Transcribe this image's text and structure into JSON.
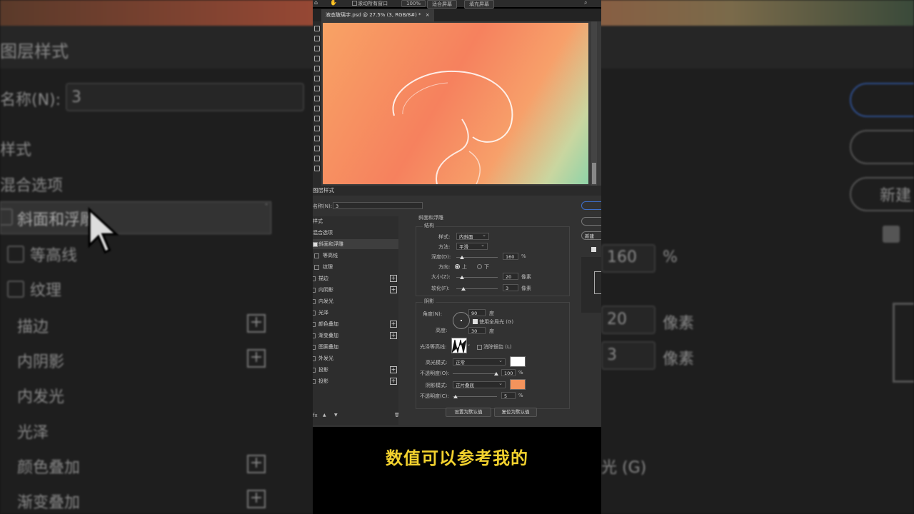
{
  "app": {
    "window_menu": {
      "scroll_all": "滚动所有窗口",
      "zoom": "100%",
      "fit_screen": "适合屏幕",
      "fill_screen": "填充屏幕"
    },
    "document_tab": "液态玻璃字.psd @ 27.5% (3, RGB/8#) *",
    "tab_close": "×"
  },
  "dialog": {
    "title": "图层样式",
    "name_label": "名称(N):",
    "name_value": "3",
    "styles_header": "样式",
    "blend_options": "混合选项",
    "items": [
      {
        "label": "斜面和浮雕",
        "checked": true,
        "plus": false,
        "active": true
      },
      {
        "label": "等高线",
        "checked": false,
        "plus": false,
        "sub": true
      },
      {
        "label": "纹理",
        "checked": false,
        "plus": false,
        "sub": true
      },
      {
        "label": "描边",
        "checked": false,
        "plus": true
      },
      {
        "label": "内阴影",
        "checked": false,
        "plus": true
      },
      {
        "label": "内发光",
        "checked": false,
        "plus": false
      },
      {
        "label": "光泽",
        "checked": false,
        "plus": false
      },
      {
        "label": "颜色叠加",
        "checked": false,
        "plus": true
      },
      {
        "label": "渐变叠加",
        "checked": false,
        "plus": true
      },
      {
        "label": "图案叠加",
        "checked": false,
        "plus": false
      },
      {
        "label": "外发光",
        "checked": false,
        "plus": false
      },
      {
        "label": "投影",
        "checked": false,
        "plus": true
      },
      {
        "label": "投影",
        "checked": false,
        "plus": true
      }
    ],
    "footer_icons": {
      "fx": "fx",
      "up": "▲",
      "down": "▼",
      "trash": "🗑"
    },
    "bevel": {
      "section_title": "斜面和浮雕",
      "structure_title": "结构",
      "style_label": "样式:",
      "style_value": "内斜面",
      "technique_label": "方法:",
      "technique_value": "平滑",
      "depth_label": "深度(D):",
      "depth_value": "160",
      "depth_unit": "%",
      "direction_label": "方向:",
      "direction_up": "上",
      "direction_down": "下",
      "size_label": "大小(Z):",
      "size_value": "20",
      "size_unit": "像素",
      "soften_label": "软化(F):",
      "soften_value": "3",
      "soften_unit": "像素",
      "shading_title": "阴影",
      "angle_label": "角度(N):",
      "angle_value": "90",
      "angle_unit": "度",
      "global_light_label": "使用全局光 (G)",
      "altitude_label": "高度:",
      "altitude_value": "30",
      "altitude_unit": "度",
      "gloss_contour_label": "光泽等高线:",
      "anti_alias_label": "消除锯齿 (L)",
      "highlight_mode_label": "高光模式:",
      "highlight_mode_value": "正常",
      "highlight_color": "#ffffff",
      "highlight_opacity_label": "不透明度(O):",
      "highlight_opacity_value": "100",
      "highlight_opacity_unit": "%",
      "shadow_mode_label": "阴影模式:",
      "shadow_mode_value": "正片叠底",
      "shadow_color": "#f3935c",
      "shadow_opacity_label": "不透明度(C):",
      "shadow_opacity_value": "5",
      "shadow_opacity_unit": "%",
      "make_default": "设置为默认值",
      "reset_default": "复位为默认值"
    },
    "right_buttons": {
      "new": "新建"
    }
  },
  "background_zoom": {
    "title": "图层样式",
    "name_label": "名称(N):",
    "name_value": "3",
    "styles": "样式",
    "blend": "混合选项",
    "items": [
      "斜面和浮雕",
      "等高线",
      "纹理",
      "描边",
      "内阴影",
      "内发光",
      "光泽",
      "颜色叠加",
      "渐变叠加"
    ],
    "depth_value": "160",
    "depth_unit": "%",
    "size_value": "20",
    "size_unit": "像素",
    "soften_value": "3",
    "soften_unit": "像素",
    "new_label": "新建",
    "global_light_fragment": "光 (G)"
  },
  "subtitle": "数值可以参考我的"
}
